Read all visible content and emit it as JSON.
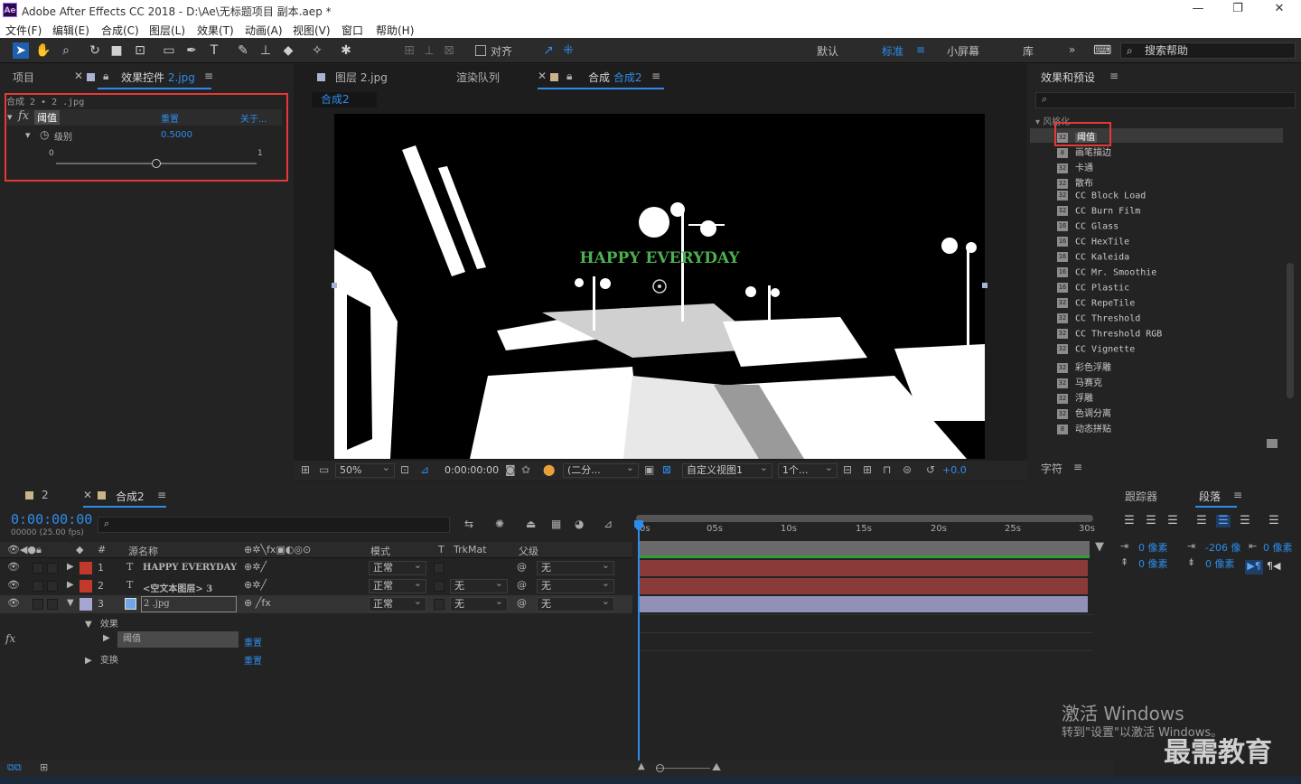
{
  "title_bar": {
    "app_badge": "Ae",
    "title": "Adobe After Effects CC 2018 - D:\\Ae\\无标题项目 副本.aep *",
    "minimize": "—",
    "restore": "❐",
    "close": "✕"
  },
  "menu": [
    "文件(F)",
    "编辑(E)",
    "合成(C)",
    "图层(L)",
    "效果(T)",
    "动画(A)",
    "视图(V)",
    "窗口",
    "帮助(H)"
  ],
  "toolbar": {
    "snap_label": "对齐",
    "workspaces": [
      "默认",
      "标准",
      "小屏幕",
      "库"
    ],
    "active_workspace": "标准",
    "search_placeholder": "搜索帮助"
  },
  "left_panel": {
    "tab_project": "项目",
    "tab_effects_prefix": "效果控件",
    "tab_effects_layer": "2.jpg",
    "breadcrumb": "合成 2 • 2 .jpg",
    "effect_name": "阈值",
    "reset": "重置",
    "about": "关于...",
    "prop_name": "级别",
    "prop_value": "0.5000",
    "slider_min": "0",
    "slider_max": "1",
    "slider_fraction": 0.5
  },
  "viewer_panel": {
    "tabs": [
      "图层 2.jpg",
      "渲染队列",
      "合成"
    ],
    "comp_tab_name": "合成2",
    "sub_tab": "合成2",
    "overlay_text": "HAPPY EVERYDAY",
    "overlay_color": "#4caf50",
    "zoom": "50%",
    "timecode": "0:00:00:00",
    "resolution": "(二分...",
    "view": "自定义视图1",
    "views_count": "1个...",
    "exposure": "+0.0"
  },
  "effects_panel": {
    "title": "效果和预设",
    "search_placeholder": "",
    "category": "风格化",
    "items": [
      "阈值",
      "画笔描边",
      "卡通",
      "散布",
      "CC Block Load",
      "CC Burn Film",
      "CC Glass",
      "CC HexTile",
      "CC Kaleida",
      "CC Mr. Smoothie",
      "CC Plastic",
      "CC RepeTile",
      "CC Threshold",
      "CC Threshold RGB",
      "CC Vignette",
      "彩色浮雕",
      "马赛克",
      "浮雕",
      "色调分离",
      "动态拼贴"
    ],
    "icon_label": "32",
    "icon_label_8": "8",
    "icon_label_16": "16"
  },
  "char_panel": {
    "title": "字符"
  },
  "timeline": {
    "tabs": [
      "2",
      "合成2"
    ],
    "timecode": "0:00:00:00",
    "fps": "00000 (25.00 fps)",
    "headers": {
      "num": "#",
      "source": "源名称",
      "mode": "模式",
      "t": "T",
      "trkmat": "TrkMat",
      "parent": "父级"
    },
    "layers": [
      {
        "num": "1",
        "type": "T",
        "name": "HAPPY EVERYDAY",
        "mode": "正常",
        "trkmat": "",
        "parent": "无",
        "color": "#c0392b"
      },
      {
        "num": "2",
        "type": "T",
        "name": "<空文本图层> 3",
        "mode": "正常",
        "trkmat": "无",
        "parent": "无",
        "color": "#c0392b"
      },
      {
        "num": "3",
        "type": "img",
        "name": "2 .jpg",
        "mode": "正常",
        "trkmat": "无",
        "parent": "无",
        "color": "#a7a6d2"
      }
    ],
    "effects_label": "效果",
    "effect_item": "阈值",
    "transform_label": "变换",
    "reset": "重置",
    "ruler": [
      "0s",
      "05s",
      "10s",
      "15s",
      "20s",
      "25s",
      "30s"
    ]
  },
  "right_bottom": {
    "tab_tracker": "跟踪器",
    "tab_paragraph": "段落",
    "indent_left": "0 像素",
    "indent_right": "0 像素",
    "first_line": "-206 像",
    "space_before": "0 像素",
    "space_after": "0 像素"
  },
  "watermark": {
    "activate_title": "激活 Windows",
    "activate_sub": "转到\"设置\"以激活 Windows。",
    "brand": "最需教育"
  }
}
